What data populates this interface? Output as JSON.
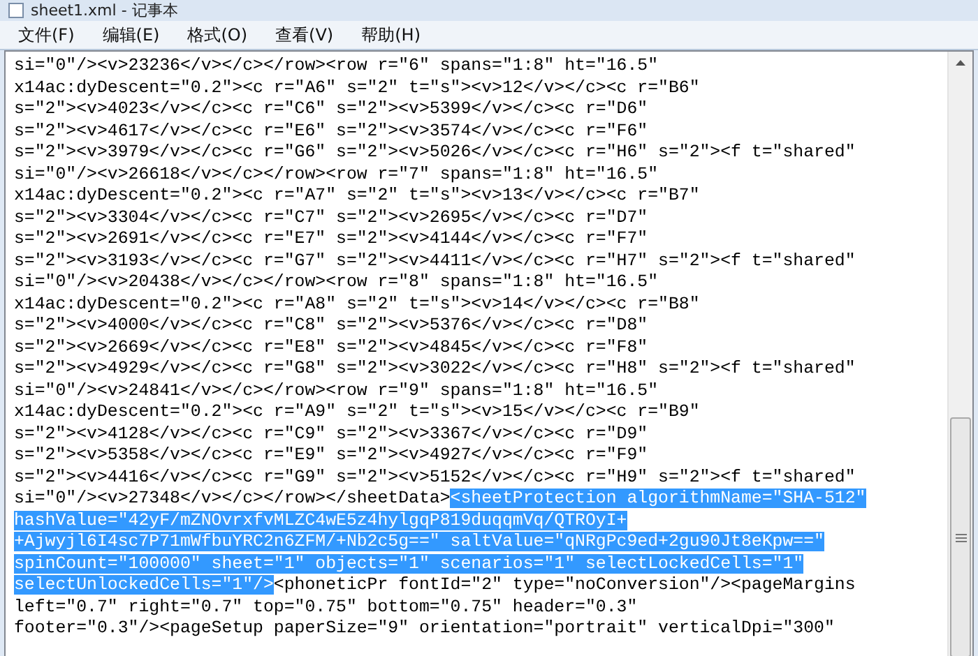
{
  "window": {
    "title": "sheet1.xml - 记事本"
  },
  "menu": [
    "文件(F)",
    "编辑(E)",
    "格式(O)",
    "查看(V)",
    "帮助(H)"
  ],
  "lines": [
    [
      {
        "text": "si=\"0\"/><v>23236</v></c></row><row r=\"6\" spans=\"1:8\" ht=\"16.5\"",
        "selected": false
      }
    ],
    [
      {
        "text": "x14ac:dyDescent=\"0.2\"><c r=\"A6\" s=\"2\" t=\"s\"><v>12</v></c><c r=\"B6\"",
        "selected": false
      }
    ],
    [
      {
        "text": "s=\"2\"><v>4023</v></c><c r=\"C6\" s=\"2\"><v>5399</v></c><c r=\"D6\"",
        "selected": false
      }
    ],
    [
      {
        "text": "s=\"2\"><v>4617</v></c><c r=\"E6\" s=\"2\"><v>3574</v></c><c r=\"F6\"",
        "selected": false
      }
    ],
    [
      {
        "text": "s=\"2\"><v>3979</v></c><c r=\"G6\" s=\"2\"><v>5026</v></c><c r=\"H6\" s=\"2\"><f t=\"shared\"",
        "selected": false
      }
    ],
    [
      {
        "text": "si=\"0\"/><v>26618</v></c></row><row r=\"7\" spans=\"1:8\" ht=\"16.5\"",
        "selected": false
      }
    ],
    [
      {
        "text": "x14ac:dyDescent=\"0.2\"><c r=\"A7\" s=\"2\" t=\"s\"><v>13</v></c><c r=\"B7\"",
        "selected": false
      }
    ],
    [
      {
        "text": "s=\"2\"><v>3304</v></c><c r=\"C7\" s=\"2\"><v>2695</v></c><c r=\"D7\"",
        "selected": false
      }
    ],
    [
      {
        "text": "s=\"2\"><v>2691</v></c><c r=\"E7\" s=\"2\"><v>4144</v></c><c r=\"F7\"",
        "selected": false
      }
    ],
    [
      {
        "text": "s=\"2\"><v>3193</v></c><c r=\"G7\" s=\"2\"><v>4411</v></c><c r=\"H7\" s=\"2\"><f t=\"shared\"",
        "selected": false
      }
    ],
    [
      {
        "text": "si=\"0\"/><v>20438</v></c></row><row r=\"8\" spans=\"1:8\" ht=\"16.5\"",
        "selected": false
      }
    ],
    [
      {
        "text": "x14ac:dyDescent=\"0.2\"><c r=\"A8\" s=\"2\" t=\"s\"><v>14</v></c><c r=\"B8\"",
        "selected": false
      }
    ],
    [
      {
        "text": "s=\"2\"><v>4000</v></c><c r=\"C8\" s=\"2\"><v>5376</v></c><c r=\"D8\"",
        "selected": false
      }
    ],
    [
      {
        "text": "s=\"2\"><v>2669</v></c><c r=\"E8\" s=\"2\"><v>4845</v></c><c r=\"F8\"",
        "selected": false
      }
    ],
    [
      {
        "text": "s=\"2\"><v>4929</v></c><c r=\"G8\" s=\"2\"><v>3022</v></c><c r=\"H8\" s=\"2\"><f t=\"shared\"",
        "selected": false
      }
    ],
    [
      {
        "text": "si=\"0\"/><v>24841</v></c></row><row r=\"9\" spans=\"1:8\" ht=\"16.5\"",
        "selected": false
      }
    ],
    [
      {
        "text": "x14ac:dyDescent=\"0.2\"><c r=\"A9\" s=\"2\" t=\"s\"><v>15</v></c><c r=\"B9\"",
        "selected": false
      }
    ],
    [
      {
        "text": "s=\"2\"><v>4128</v></c><c r=\"C9\" s=\"2\"><v>3367</v></c><c r=\"D9\"",
        "selected": false
      }
    ],
    [
      {
        "text": "s=\"2\"><v>5358</v></c><c r=\"E9\" s=\"2\"><v>4927</v></c><c r=\"F9\"",
        "selected": false
      }
    ],
    [
      {
        "text": "s=\"2\"><v>4416</v></c><c r=\"G9\" s=\"2\"><v>5152</v></c><c r=\"H9\" s=\"2\"><f t=\"shared\"",
        "selected": false
      }
    ],
    [
      {
        "text": "si=\"0\"/><v>27348</v></c></row></sheetData>",
        "selected": false
      },
      {
        "text": "<sheetProtection algorithmName=\"SHA-512\"",
        "selected": true
      }
    ],
    [
      {
        "text": "hashValue=\"42yF/mZNOvrxfvMLZC4wE5z4hylgqP819duqqmVq/QTROyI+",
        "selected": true
      }
    ],
    [
      {
        "text": "+Ajwyjl6I4sc7P71mWfbuYRC2n6ZFM/+Nb2c5g==\" saltValue=\"qNRgPc9ed+2gu90Jt8eKpw==\"",
        "selected": true
      }
    ],
    [
      {
        "text": "spinCount=\"100000\" sheet=\"1\" objects=\"1\" scenarios=\"1\" selectLockedCells=\"1\"",
        "selected": true
      }
    ],
    [
      {
        "text": "selectUnlockedCells=\"1\"/>",
        "selected": true
      },
      {
        "text": "<phoneticPr fontId=\"2\" type=\"noConversion\"/><pageMargins",
        "selected": false
      }
    ],
    [
      {
        "text": "left=\"0.7\" right=\"0.7\" top=\"0.75\" bottom=\"0.75\" header=\"0.3\"",
        "selected": false
      }
    ],
    [
      {
        "text": "footer=\"0.3\"/><pageSetup paperSize=\"9\" orientation=\"portrait\" verticalDpi=\"300\"",
        "selected": false
      }
    ]
  ]
}
